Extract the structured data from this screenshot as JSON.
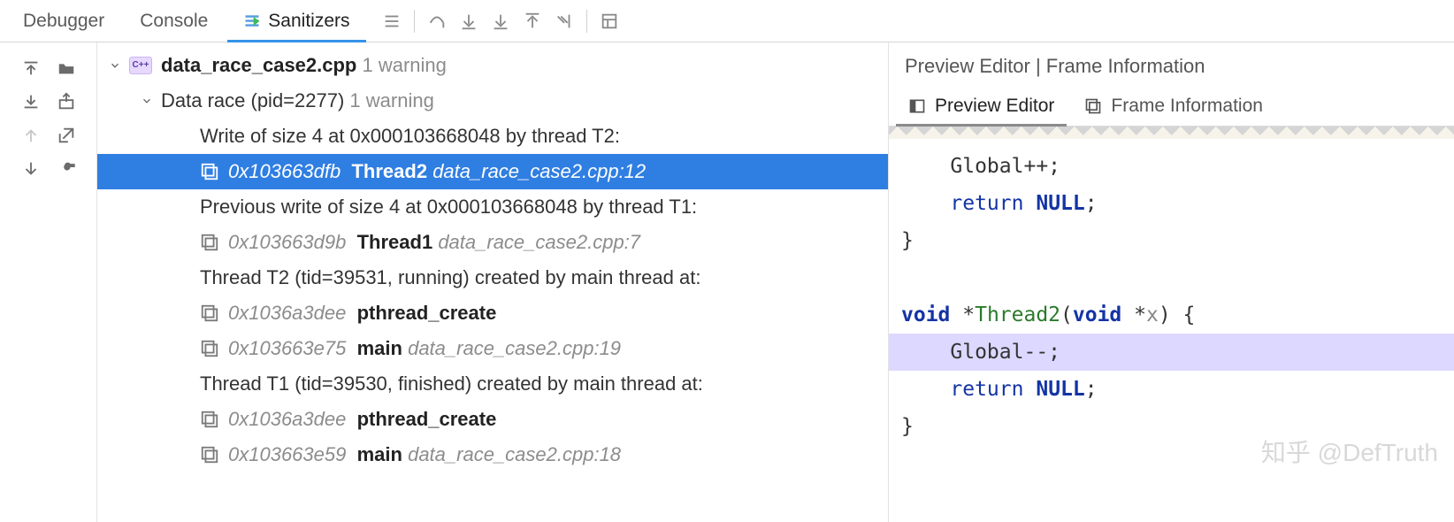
{
  "topbar": {
    "tabs": [
      {
        "label": "Debugger"
      },
      {
        "label": "Console"
      },
      {
        "label": "Sanitizers",
        "active": true
      }
    ]
  },
  "tree": {
    "file": {
      "name": "data_race_case2.cpp",
      "warn": "1 warning"
    },
    "race": {
      "label": "Data race (pid=2277)",
      "warn": "1 warning"
    },
    "rows": [
      {
        "kind": "msg",
        "text": "Write of size 4 at 0x000103668048 by thread T2:"
      },
      {
        "kind": "frame",
        "addr": "0x103663dfb",
        "func": "Thread2",
        "loc": "data_race_case2.cpp:12",
        "selected": true
      },
      {
        "kind": "msg",
        "text": "Previous write of size 4 at 0x000103668048 by thread T1:"
      },
      {
        "kind": "frame",
        "addr": "0x103663d9b",
        "func": "Thread1",
        "loc": "data_race_case2.cpp:7"
      },
      {
        "kind": "msg",
        "text": "Thread T2 (tid=39531, running) created by main thread at:"
      },
      {
        "kind": "frame",
        "addr": "0x1036a3dee",
        "func": "pthread_create",
        "loc": ""
      },
      {
        "kind": "frame",
        "addr": "0x103663e75",
        "func": "main",
        "loc": "data_race_case2.cpp:19"
      },
      {
        "kind": "msg",
        "text": "Thread T1 (tid=39530, finished) created by main thread at:"
      },
      {
        "kind": "frame",
        "addr": "0x1036a3dee",
        "func": "pthread_create",
        "loc": ""
      },
      {
        "kind": "frame",
        "addr": "0x103663e59",
        "func": "main",
        "loc": "data_race_case2.cpp:18"
      }
    ]
  },
  "right": {
    "title": "Preview Editor | Frame Information",
    "tabs": [
      {
        "label": "Preview Editor",
        "active": true
      },
      {
        "label": "Frame Information"
      }
    ],
    "code_lines": [
      {
        "t": "    Global++;"
      },
      {
        "t": "    return NULL;",
        "ret": true
      },
      {
        "t": "}"
      },
      {
        "t": ""
      },
      {
        "t": "void *Thread2(void *x) {",
        "sig": true
      },
      {
        "t": "    Global--;",
        "hl": true
      },
      {
        "t": "    return NULL;",
        "ret": true
      },
      {
        "t": "}"
      }
    ]
  },
  "watermark": "知乎 @DefTruth"
}
